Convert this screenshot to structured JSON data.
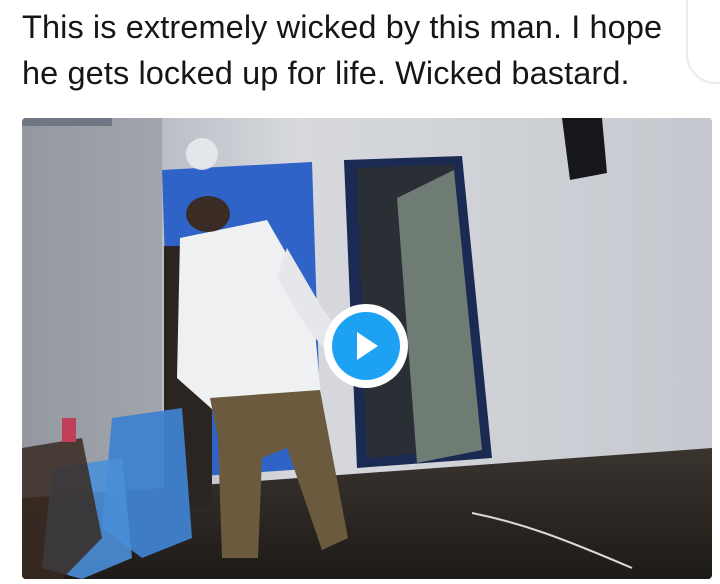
{
  "tweet": {
    "text": "This is extremely wicked by this man. I hope he gets locked up for life. Wicked bastard."
  },
  "media": {
    "type": "video",
    "play_icon": "play-icon",
    "accent_color": "#1da1f2"
  }
}
